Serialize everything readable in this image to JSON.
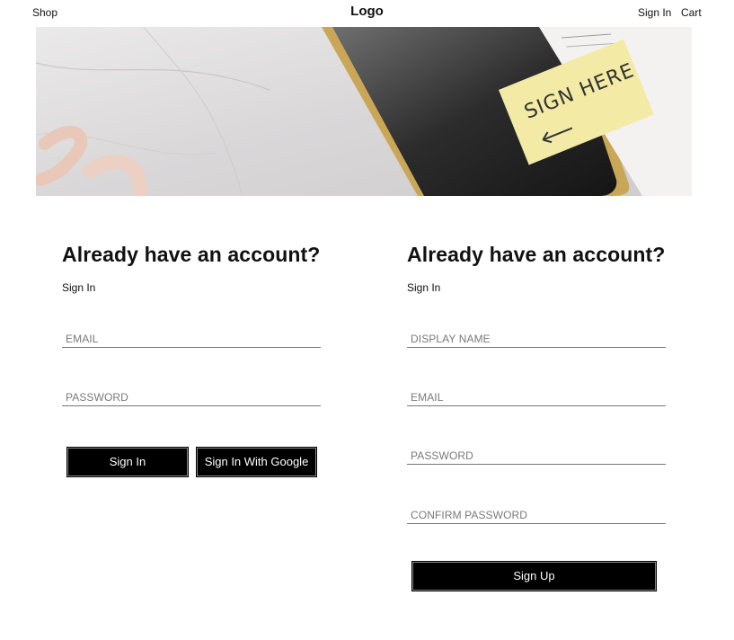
{
  "nav": {
    "shop": "Shop",
    "logo": "Logo",
    "sign_in": "Sign In",
    "cart": "Cart"
  },
  "hero": {
    "note_text": "SIGN HERE",
    "icon": "sign-here-hero-image"
  },
  "sign_in_form": {
    "title": "Already have an account?",
    "subtitle": "Sign In",
    "email_placeholder": "EMAIL",
    "password_placeholder": "PASSWORD",
    "sign_in_button": "Sign In",
    "google_button": "Sign In With Google"
  },
  "sign_up_form": {
    "title": "Already have an account?",
    "subtitle": "Sign In",
    "display_name_placeholder": "DISPLAY NAME",
    "email_placeholder": "EMAIL",
    "password_placeholder": "PASSWORD",
    "confirm_password_placeholder": "CONFIRM PASSWORD",
    "sign_up_button": "Sign Up"
  },
  "colors": {
    "button_bg": "#000000",
    "button_text": "#ffffff",
    "note_yellow": "#f3eaa6"
  }
}
